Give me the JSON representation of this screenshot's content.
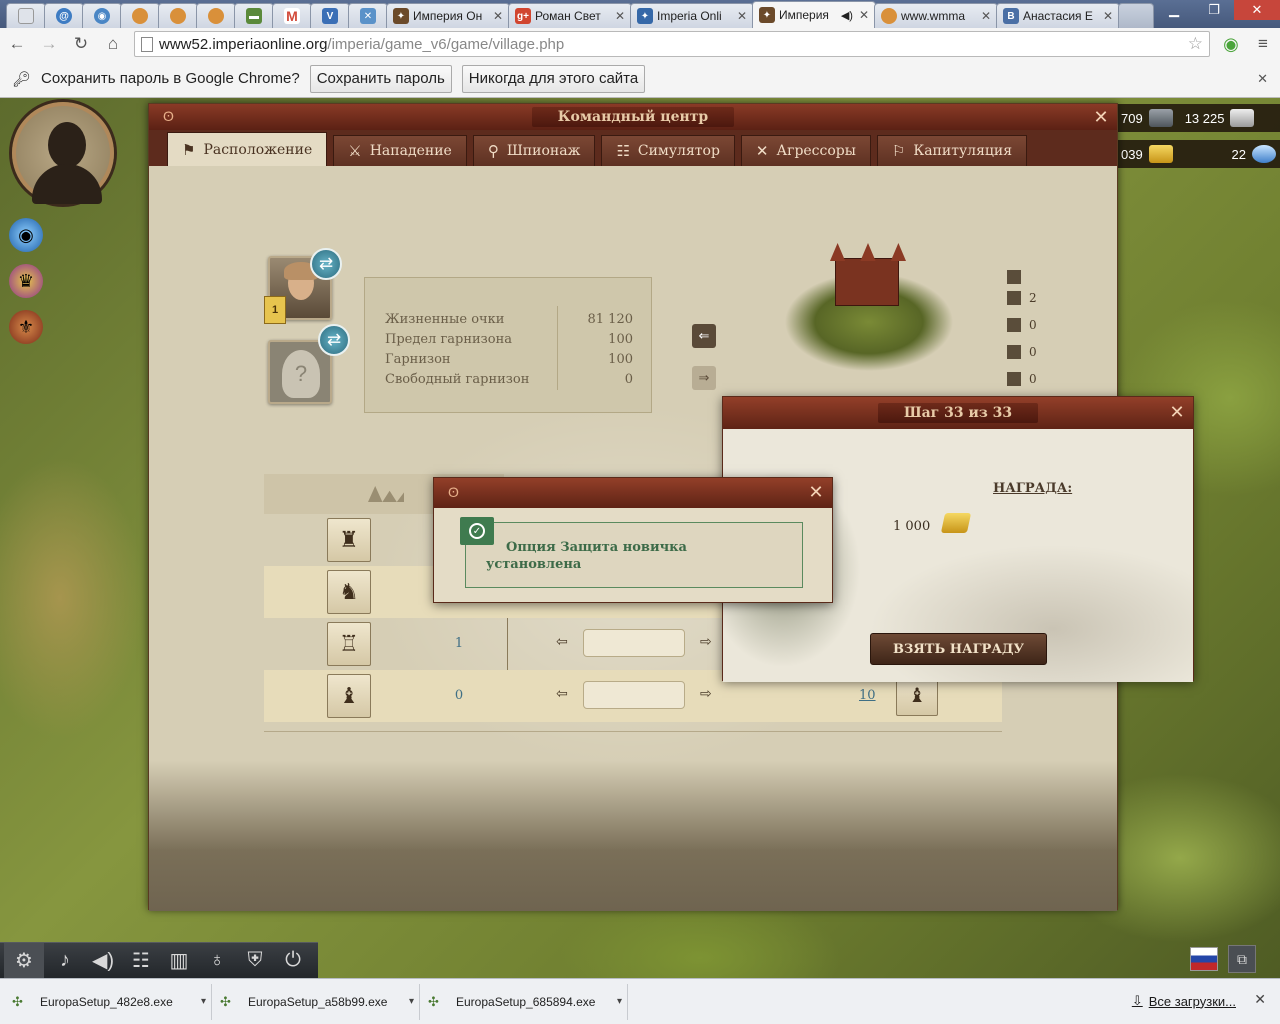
{
  "browser": {
    "tabs": [
      {
        "title": "",
        "favicon": "blank-page",
        "color": "#d8dde6"
      },
      {
        "title": "",
        "favicon": "blue-circle",
        "color": "#3e7cc3"
      },
      {
        "title": "",
        "favicon": "globe",
        "color": "#4a86c5"
      },
      {
        "title": "",
        "favicon": "imperia-coin",
        "color": "#d9903a"
      },
      {
        "title": "",
        "favicon": "imperia-coin",
        "color": "#d9903a"
      },
      {
        "title": "",
        "favicon": "imperia-coin",
        "color": "#d9903a"
      },
      {
        "title": "",
        "favicon": "flag",
        "color": "#5b8a3b"
      },
      {
        "title": "",
        "favicon": "gmail",
        "color": "#d24a3a"
      },
      {
        "title": "",
        "favicon": "v-letter",
        "color": "#3b6fb6"
      },
      {
        "title": "",
        "favicon": "crossed",
        "color": "#5a92c9"
      },
      {
        "title": "Империя Он",
        "favicon": "imperia",
        "color": "#6b4a2a"
      },
      {
        "title": "Роман Свет",
        "favicon": "g-plus",
        "color": "#d1452f"
      },
      {
        "title": "Imperia Onli",
        "favicon": "imperia-blue",
        "color": "#3568a8"
      },
      {
        "title": "Империя",
        "favicon": "imperia",
        "color": "#6b4a2a",
        "active": true
      },
      {
        "title": "www.wmma",
        "favicon": "imperia-coin",
        "color": "#d9903a"
      },
      {
        "title": "Анастасия Е",
        "favicon": "vk",
        "color": "#4a6fa5"
      }
    ],
    "url_domain": "www52.imperiaonline.org",
    "url_path": "/imperia/game_v6/game/village.php",
    "password_prompt": {
      "text": "Сохранить пароль в Google Chrome?",
      "save_label": "Сохранить пароль",
      "never_label": "Никогда для этого сайта"
    }
  },
  "game": {
    "resources": {
      "iron": "709",
      "stone": "13 225",
      "gold": "039",
      "diamonds": "22"
    },
    "command_center": {
      "title": "Командный центр",
      "tabs": [
        {
          "label": "Расположение",
          "icon": "flag-pole-icon"
        },
        {
          "label": "Нападение",
          "icon": "sword-icon"
        },
        {
          "label": "Шпионаж",
          "icon": "keyhole-icon"
        },
        {
          "label": "Симулятор",
          "icon": "simulator-icon"
        },
        {
          "label": "Агрессоры",
          "icon": "crossed-swords-icon"
        },
        {
          "label": "Капитуляция",
          "icon": "white-flag-icon"
        }
      ],
      "hero_level": "1",
      "stats": [
        {
          "label": "Жизненные очки",
          "value": "81 120"
        },
        {
          "label": "Предел гарнизона",
          "value": "100"
        },
        {
          "label": "Гарнизон",
          "value": "100"
        },
        {
          "label": "Свободный гарнизон",
          "value": "0"
        }
      ],
      "castle_counts": [
        "2",
        "0",
        "0",
        "0"
      ],
      "unit_rows": [
        {
          "icon": "swordsman-icon",
          "count": "",
          "target": ""
        },
        {
          "icon": "spearman-icon",
          "count": "",
          "target": ""
        },
        {
          "icon": "siege-tower-icon",
          "count": "1",
          "target": ""
        },
        {
          "icon": "catapult-icon",
          "count": "0",
          "target": "10"
        }
      ]
    },
    "step_dialog": {
      "title": "Шаг 33 из 33",
      "reward_label": "НАГРАДА:",
      "reward_amount": "1 000",
      "take_button": "ВЗЯТЬ НАГРАДУ"
    },
    "notice": {
      "text": "Опция Защита новичка установлена"
    }
  },
  "downloads": {
    "items": [
      "EuropaSetup_482e8.exe",
      "EuropaSetup_a58b99.exe",
      "EuropaSetup_685894.exe"
    ],
    "all_label": "Все загрузки..."
  }
}
